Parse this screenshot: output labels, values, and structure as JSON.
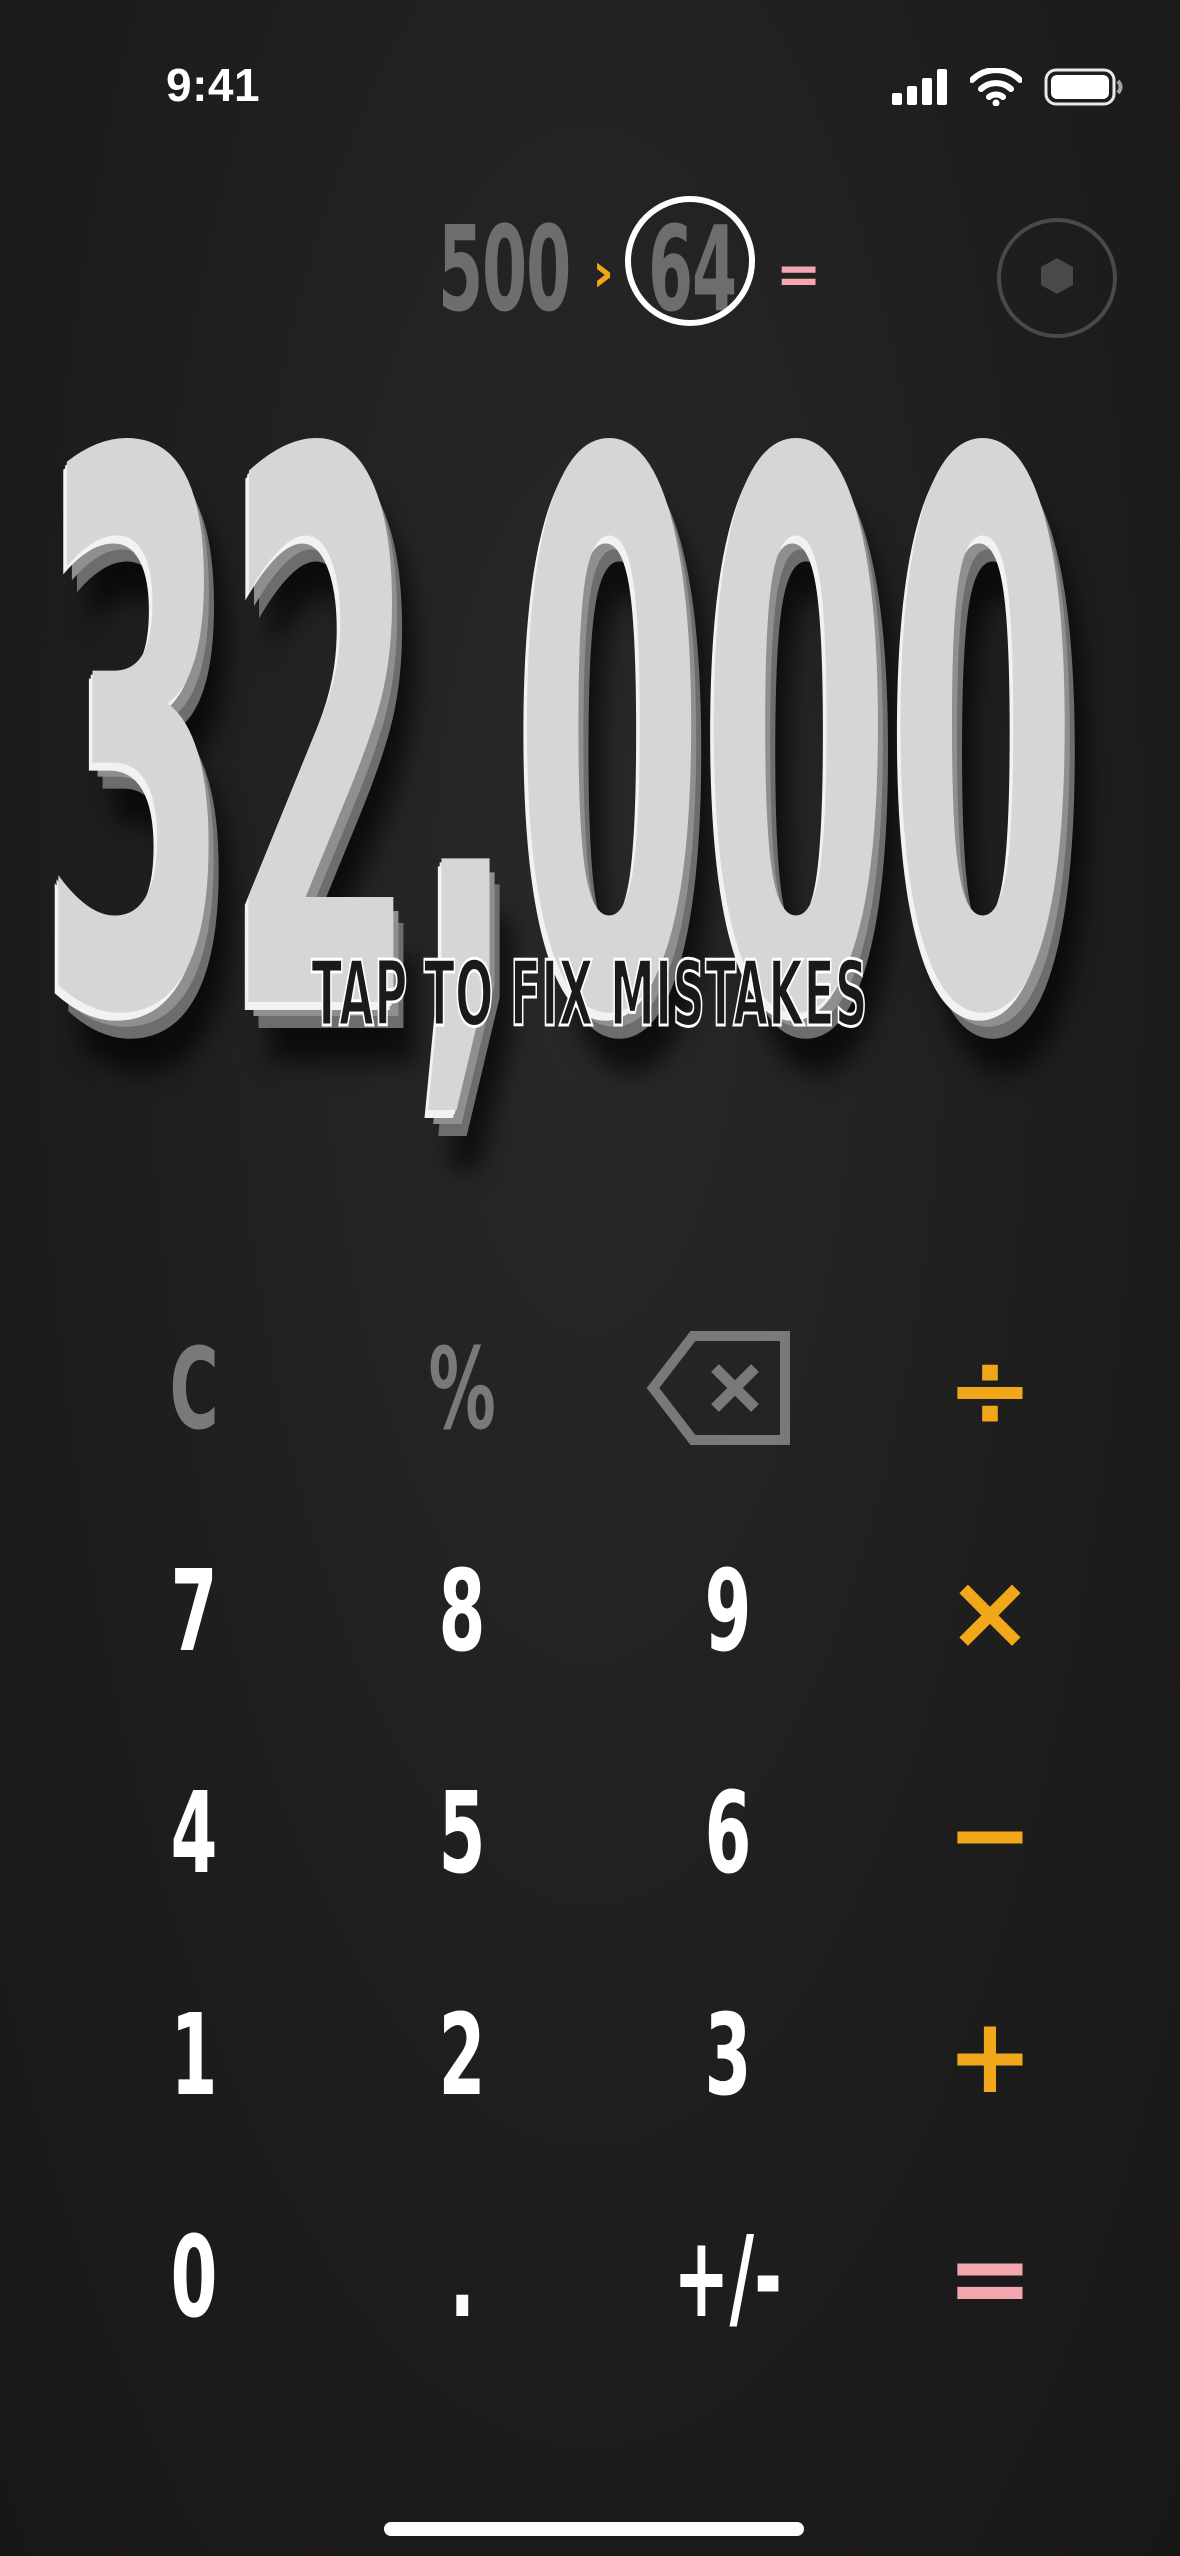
{
  "status_bar": {
    "time": "9:41",
    "icons": [
      "cellular-signal-icon",
      "wifi-icon",
      "battery-icon"
    ]
  },
  "tape": {
    "operand_1": "500",
    "operator_1": "›",
    "operand_2": "64",
    "operator_2": "=",
    "colors": {
      "operand": "#6e6d6d",
      "operator_1": "#f0a81a",
      "operator_2": "#f2a6ae"
    }
  },
  "settings": {
    "icon": "hexagon-icon"
  },
  "display": {
    "value": "32,000",
    "hint": "TAP TO FIX MISTAKES"
  },
  "keypad": {
    "clear": "C",
    "percent": "%",
    "backspace_icon": "backspace-icon",
    "divide": "÷",
    "multiply": "×",
    "subtract": "−",
    "add": "+",
    "equals": "=",
    "digit_7": "7",
    "digit_8": "8",
    "digit_9": "9",
    "digit_4": "4",
    "digit_5": "5",
    "digit_6": "6",
    "digit_1": "1",
    "digit_2": "2",
    "digit_3": "3",
    "digit_0": "0",
    "decimal": ".",
    "negate": "+/-",
    "colors": {
      "digit": "#ffffff",
      "function": "#7a7979",
      "operator": "#f0a81a",
      "equals": "#f2a6ae"
    }
  }
}
